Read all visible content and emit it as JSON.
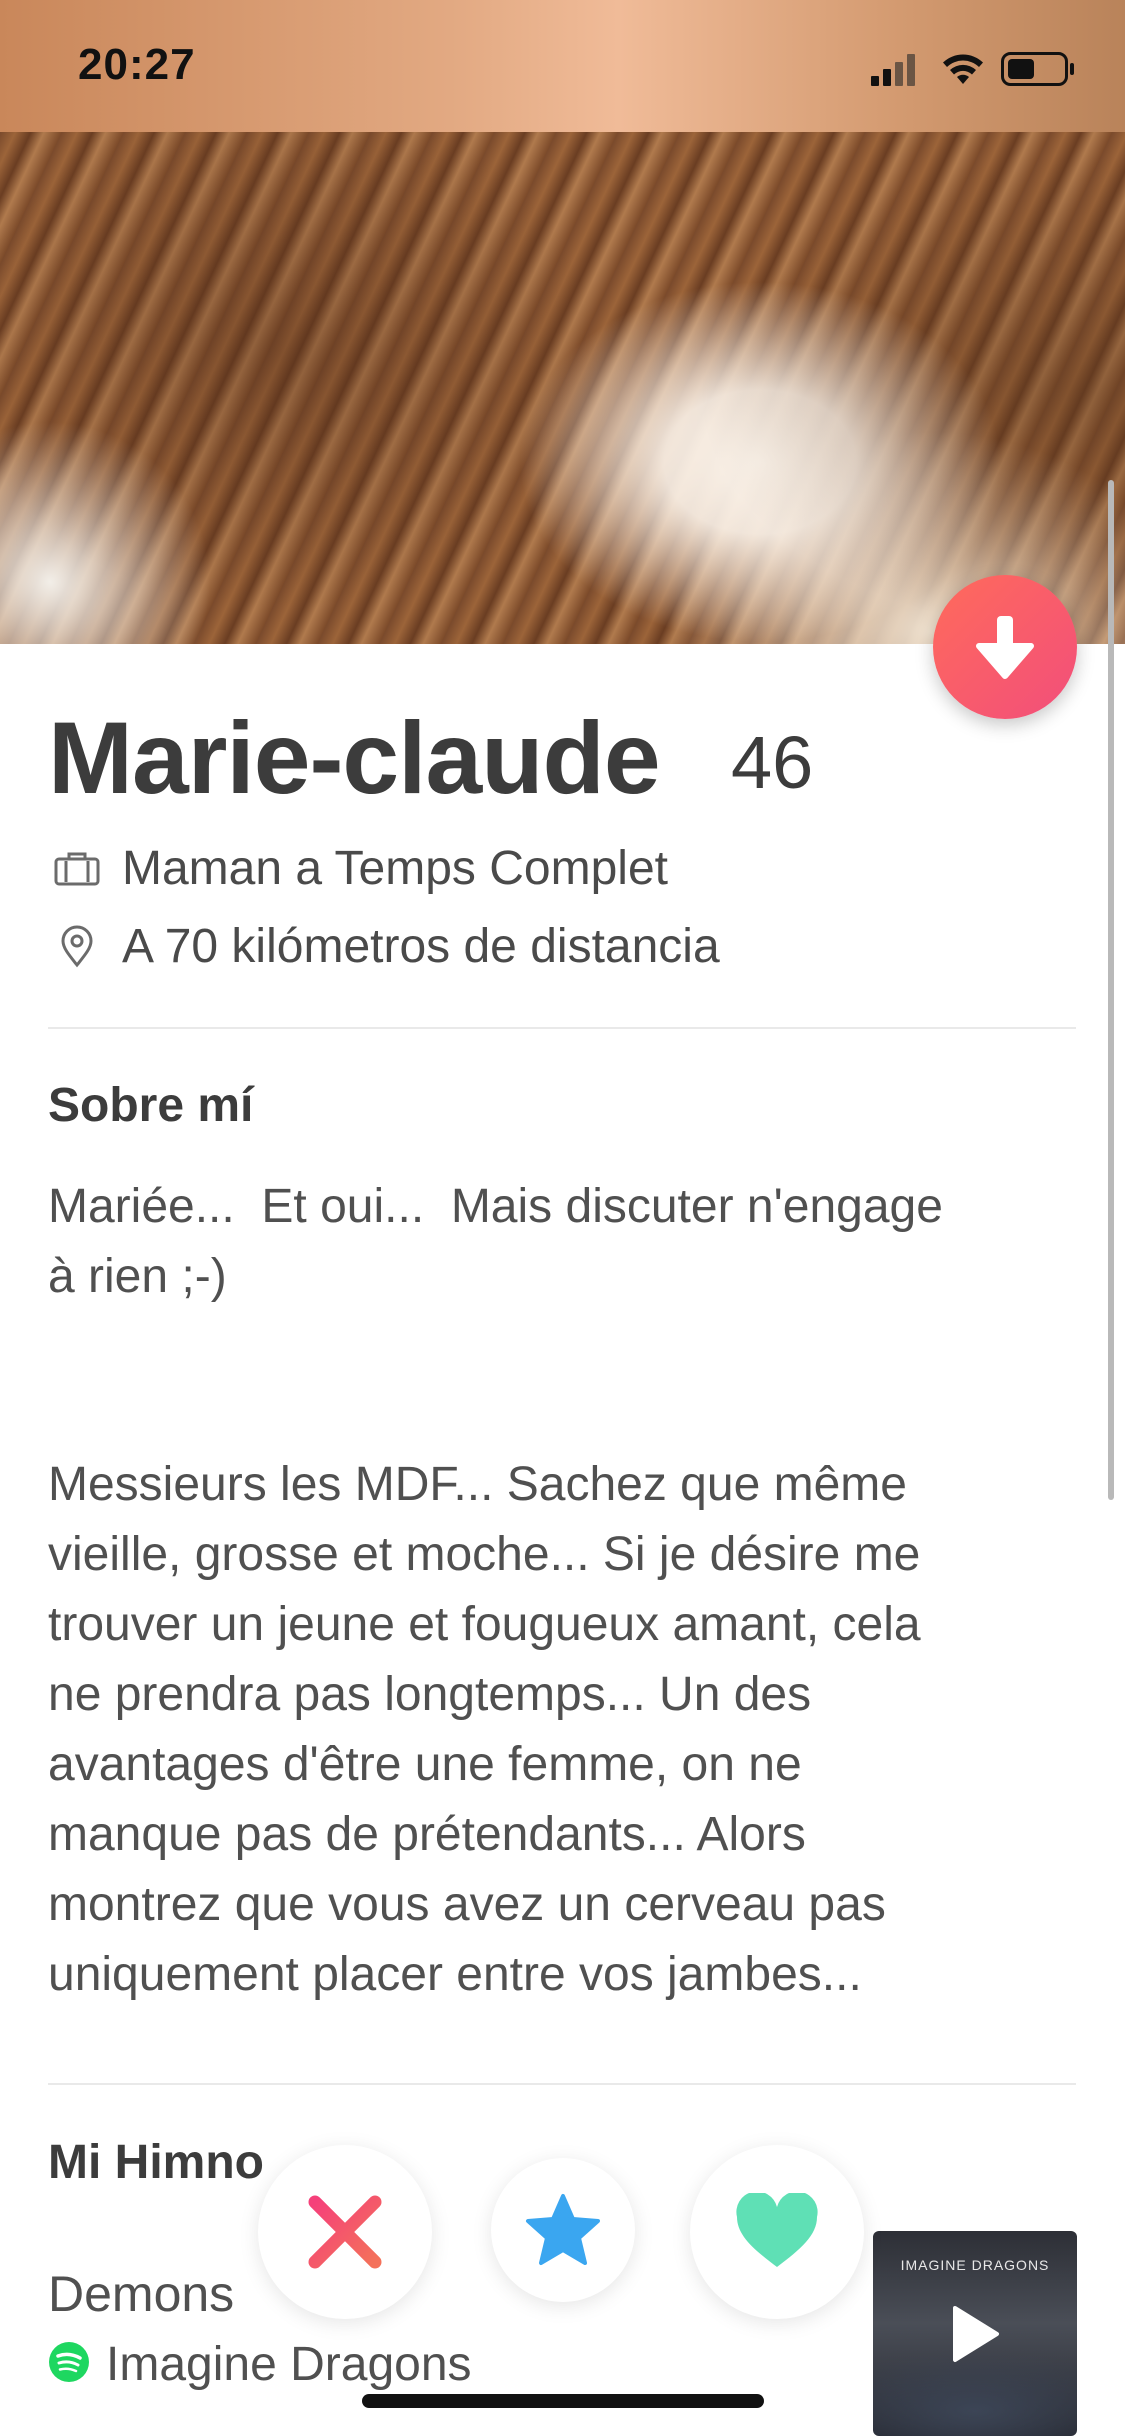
{
  "status": {
    "time": "20:27",
    "icons": [
      "signal-icon",
      "wifi-icon",
      "battery-icon"
    ]
  },
  "profile": {
    "name": "Marie-claude",
    "age": "46",
    "job": "Maman a Temps Complet",
    "distance": "A 70 kilómetros de distancia"
  },
  "about": {
    "title": "Sobre mí",
    "paragraph1": "Mariée...  Et oui...  Mais discuter n'engage\nà rien ;-)",
    "paragraph2": "Messieurs les MDF... Sachez que même\nvieille, grosse et moche... Si je désire me\ntrouver un jeune et fougueux amant, cela\nne prendra pas longtemps... Un des\navantages d'être une femme, on ne\nmanque pas de prétendants... Alors\nmontrez que vous avez un cerveau pas\nuniquement placer entre vos jambes..."
  },
  "anthem": {
    "title": "Mi Himno",
    "song": "Demons",
    "artist": "Imagine Dragons",
    "album_text": "IMAGINE DRAGONS"
  },
  "actions": {
    "nope_icon": "close-icon",
    "superlike_icon": "star-icon",
    "like_icon": "heart-icon",
    "collapse_icon": "arrow-down-icon"
  },
  "colors": {
    "accent": "#f24e7b",
    "nope": "#f25c5c",
    "superlike": "#3aa6f0",
    "like": "#5fe0b5",
    "spotify": "#1ed760"
  }
}
